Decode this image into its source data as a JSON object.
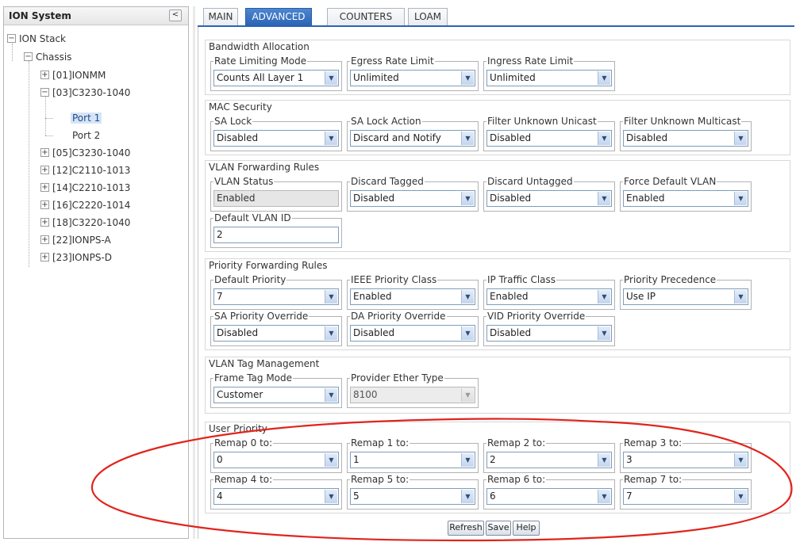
{
  "tree": {
    "header": "ION System",
    "collapse_glyph": "<",
    "root": "ION Stack",
    "chassis": "Chassis",
    "items": {
      "ionmm": "[01]IONMM",
      "c3230a": "[03]C3230-1040",
      "port1": "Port 1",
      "port2": "Port 2",
      "c3230b": "[05]C3230-1040",
      "c2110": "[12]C2110-1013",
      "c2210": "[14]C2210-1013",
      "c2220": "[16]C2220-1014",
      "c3220": "[18]C3220-1040",
      "ionpsa": "[22]IONPS-A",
      "ionpsd": "[23]IONPS-D"
    },
    "plus": "+",
    "minus": "−"
  },
  "tabs": {
    "main": "MAIN",
    "advanced": "ADVANCED",
    "counters": "COUNTERS",
    "loam": "LOAM"
  },
  "bandwidth": {
    "title": "Bandwidth Allocation",
    "rate_limiting_mode": {
      "label": "Rate Limiting Mode",
      "value": "Counts All Layer 1"
    },
    "egress": {
      "label": "Egress Rate Limit",
      "value": "Unlimited"
    },
    "ingress": {
      "label": "Ingress Rate Limit",
      "value": "Unlimited"
    }
  },
  "mac_security": {
    "title": "MAC Security",
    "sa_lock": {
      "label": "SA Lock",
      "value": "Disabled"
    },
    "sa_lock_action": {
      "label": "SA Lock Action",
      "value": "Discard and Notify"
    },
    "filter_unicast": {
      "label": "Filter Unknown Unicast",
      "value": "Disabled"
    },
    "filter_multicast": {
      "label": "Filter Unknown Multicast",
      "value": "Disabled"
    }
  },
  "vlan_forwarding": {
    "title": "VLAN Forwarding Rules",
    "vlan_status": {
      "label": "VLAN Status",
      "value": "Enabled"
    },
    "discard_tagged": {
      "label": "Discard Tagged",
      "value": "Disabled"
    },
    "discard_untagged": {
      "label": "Discard Untagged",
      "value": "Disabled"
    },
    "force_default_vlan": {
      "label": "Force Default VLAN",
      "value": "Enabled"
    },
    "default_vlan_id": {
      "label": "Default VLAN ID",
      "value": "2"
    }
  },
  "priority_forwarding": {
    "title": "Priority Forwarding Rules",
    "default_priority": {
      "label": "Default Priority",
      "value": "7"
    },
    "ieee_priority_class": {
      "label": "IEEE Priority Class",
      "value": "Enabled"
    },
    "ip_traffic_class": {
      "label": "IP Traffic Class",
      "value": "Enabled"
    },
    "priority_precedence": {
      "label": "Priority Precedence",
      "value": "Use IP"
    },
    "sa_priority_override": {
      "label": "SA Priority Override",
      "value": "Disabled"
    },
    "da_priority_override": {
      "label": "DA Priority Override",
      "value": "Disabled"
    },
    "vid_priority_override": {
      "label": "VID Priority Override",
      "value": "Disabled"
    }
  },
  "vlan_tag": {
    "title": "VLAN Tag Management",
    "frame_tag_mode": {
      "label": "Frame Tag Mode",
      "value": "Customer"
    },
    "provider_ether_type": {
      "label": "Provider Ether Type",
      "value": "8100"
    }
  },
  "user_priority": {
    "title": "User Priority",
    "remaps": [
      {
        "label": "Remap 0 to:",
        "value": "0"
      },
      {
        "label": "Remap 1 to:",
        "value": "1"
      },
      {
        "label": "Remap 2 to:",
        "value": "2"
      },
      {
        "label": "Remap 3 to:",
        "value": "3"
      },
      {
        "label": "Remap 4 to:",
        "value": "4"
      },
      {
        "label": "Remap 5 to:",
        "value": "5"
      },
      {
        "label": "Remap 6 to:",
        "value": "6"
      },
      {
        "label": "Remap 7 to:",
        "value": "7"
      }
    ]
  },
  "buttons": {
    "refresh": "Refresh",
    "save": "Save",
    "help": "Help"
  },
  "icons": {
    "dropdown_arrow": "▼"
  },
  "colors": {
    "active_tab": "#2a63b4",
    "annotation": "#e0241c"
  }
}
